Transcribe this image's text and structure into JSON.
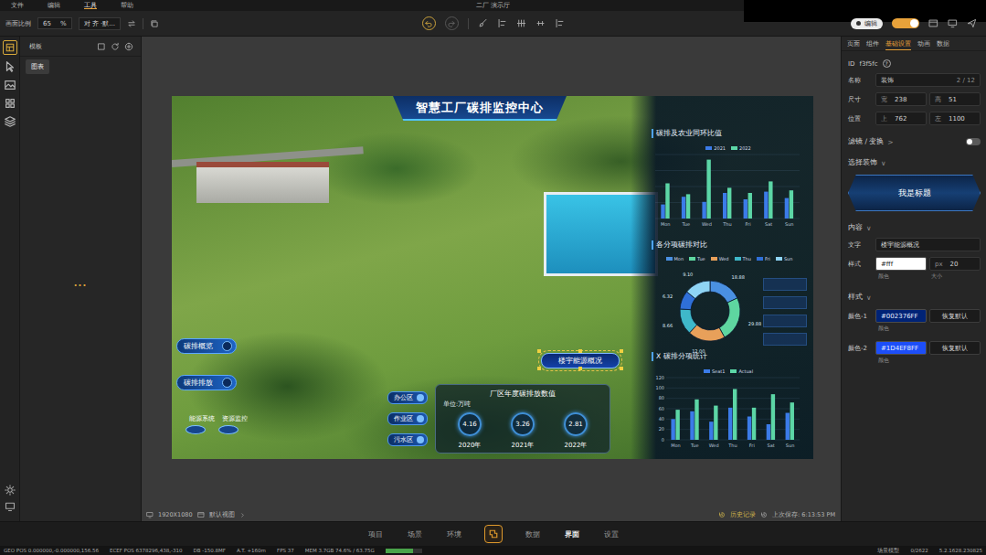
{
  "menu": [
    {
      "label": "文件",
      "selected": false
    },
    {
      "label": "编辑",
      "selected": false
    },
    {
      "label": "工具",
      "selected": true
    },
    {
      "label": "帮助",
      "selected": false
    }
  ],
  "window": {
    "title": "二厂 演示厅"
  },
  "toolbar": {
    "zoom_label": "画面比例",
    "zoom_value": "65",
    "zoom_unit": "%",
    "align": "对 齐 ·默..."
  },
  "mode": {
    "label": "编辑",
    "on": true
  },
  "rail": {
    "tooltip": "图表"
  },
  "left_panel": {
    "title": "模板",
    "loading": "..."
  },
  "dashboard": {
    "title": "智慧工厂碳排监控中心",
    "chart1": {
      "title": "碳排及农业同环比值",
      "legend": [
        {
          "label": "2021",
          "color": "#3b7be8"
        },
        {
          "label": "2022",
          "color": "#5cd6a6"
        }
      ],
      "categories": [
        "Mon",
        "Tue",
        "Wed",
        "Thu",
        "Fri",
        "Sat",
        "Sun"
      ],
      "max": 100,
      "series": [
        {
          "values": [
            22,
            34,
            26,
            40,
            30,
            42,
            32
          ]
        },
        {
          "values": [
            55,
            38,
            92,
            48,
            40,
            58,
            44
          ]
        }
      ]
    },
    "chart2": {
      "title": "各分项碳排对比",
      "segments": [
        {
          "legend": "Mon",
          "label": "18.88",
          "value": 18,
          "color": "#4a90e2"
        },
        {
          "legend": "Tue",
          "label": "29.88",
          "value": 24,
          "color": "#5ed6a0"
        },
        {
          "legend": "Wed",
          "label": "12.00",
          "value": 20,
          "color": "#e8a05a"
        },
        {
          "legend": "Thu",
          "label": "8.66",
          "value": 14,
          "color": "#3fb8c9"
        },
        {
          "legend": "Fri",
          "label": "6.32",
          "value": 10,
          "color": "#2f6fd8"
        },
        {
          "legend": "Sun",
          "label": "9.10",
          "value": 14,
          "color": "#8fd4f5"
        }
      ]
    },
    "chart3": {
      "title": "X 碳排分项统计",
      "legend": [
        {
          "label": "Seat1",
          "color": "#3b7be8"
        },
        {
          "label": "Actual",
          "color": "#5cd6a6"
        }
      ],
      "categories": [
        "Mon",
        "Tue",
        "Wed",
        "Thu",
        "Fri",
        "Sat",
        "Sun"
      ],
      "ticks": [
        "120",
        "100",
        "80",
        "60",
        "40",
        "20",
        "0"
      ],
      "max": 120,
      "series": [
        {
          "values": [
            40,
            55,
            35,
            62,
            45,
            30,
            52
          ]
        },
        {
          "values": [
            58,
            78,
            66,
            98,
            62,
            88,
            72
          ]
        }
      ]
    },
    "nav_buttons": [
      {
        "label": "碳排概览"
      },
      {
        "label": "碳排排放"
      }
    ],
    "round_buttons": [
      {
        "label": "能源系统"
      },
      {
        "label": "资源监控"
      }
    ],
    "zones": [
      {
        "label": "办公区"
      },
      {
        "label": "作业区"
      },
      {
        "label": "污水区"
      }
    ],
    "annual": {
      "title": "厂区年度碳排放数值",
      "unit": "单位:万吨",
      "items": [
        {
          "value": "4.16",
          "year": "2020年"
        },
        {
          "value": "3.26",
          "year": "2021年"
        },
        {
          "value": "2.81",
          "year": "2022年"
        }
      ]
    },
    "selected_element": {
      "label": "楼宇能源概况",
      "selected": true
    }
  },
  "right_panel": {
    "tabs": [
      {
        "label": "页面",
        "selected": false
      },
      {
        "label": "组件",
        "selected": false
      },
      {
        "label": "基础设置",
        "selected": true
      },
      {
        "label": "动画",
        "selected": false
      },
      {
        "label": "数据",
        "selected": false
      }
    ],
    "id": {
      "label": "ID",
      "value": "f3f5fc",
      "help": "?"
    },
    "name": {
      "label": "名称",
      "value": "装饰",
      "count": "2 / 12"
    },
    "size": {
      "label": "尺寸",
      "width_label": "宽",
      "width": "238",
      "height_label": "高",
      "height": "51"
    },
    "position": {
      "label": "位置",
      "top_label": "上",
      "top": "762",
      "left_label": "左",
      "left": "1100"
    },
    "filter": {
      "label": "滤镜 / 变换",
      "arrow": ">",
      "on": false
    },
    "decor": {
      "label": "选择装饰",
      "arrow": "∨",
      "preview": "我是标题"
    },
    "content": {
      "label": "内容",
      "arrow": "∨",
      "text_label": "文字",
      "text": "楼宇能源概况",
      "style_label": "样式",
      "color": "#fff",
      "size_unit": "px",
      "size": "20",
      "color_caption": "颜色",
      "size_caption": "大小"
    },
    "style": {
      "label": "样式",
      "arrow": "∨",
      "colors": [
        {
          "label": "颜色-1",
          "value": "#002376FF",
          "color": "#002376",
          "reset": "恢复默认",
          "caption": "颜色"
        },
        {
          "label": "颜色-2",
          "value": "#1D4EF8FF",
          "color": "#1d4ef8",
          "reset": "恢复默认",
          "caption": "颜色"
        }
      ]
    }
  },
  "canvas_status": {
    "resolution": "1920X1080",
    "view": "默认视图",
    "history": "历史记录",
    "saved": "上次保存: 6:13:53 PM"
  },
  "bottom_nav": [
    {
      "label": "项目",
      "selected": false
    },
    {
      "label": "场景",
      "selected": false
    },
    {
      "label": "环境",
      "selected": false
    },
    {
      "label": "数据",
      "selected": false
    },
    {
      "label": "界面",
      "selected": true
    },
    {
      "label": "设置",
      "selected": false
    }
  ],
  "status_bar": {
    "left": [
      "GEO POS 0.000000,-0.000000,156.56",
      "ECEF POS 6378296,438,-310",
      "DB -150.8MF",
      "A.T. +160m",
      "FPS 37",
      "MEM 3.7GB 74.6% / 63.75G"
    ],
    "mem_level": 0.75,
    "right": [
      "场景模型",
      "0/2622",
      "5.2.1628.230825"
    ]
  }
}
